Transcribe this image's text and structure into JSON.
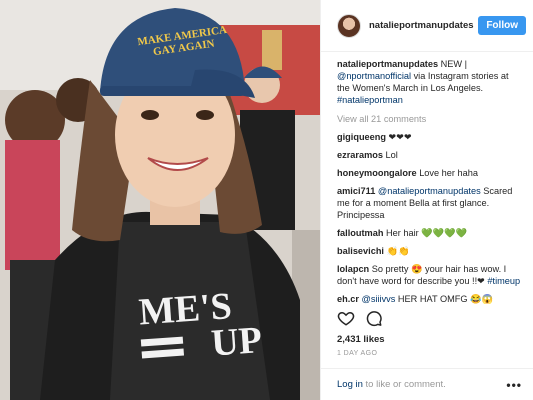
{
  "post": {
    "username": "natalieportmanupdates",
    "follow_label": "Follow",
    "caption_user": "natalieportmanupdates",
    "caption_text_1": " NEW | ",
    "caption_mention": "@nportmanofficial",
    "caption_text_2": " via Instagram stories at the Women's March in Los Angeles. ",
    "caption_hashtag": "#natalieportman",
    "view_all": "View all 21 comments",
    "likes": "2,431 likes",
    "date": "1 DAY AGO",
    "login_link": "Log in",
    "login_text": " to like or comment.",
    "more": "•••"
  },
  "photo": {
    "cap_text_1": "MAKE AMERICA",
    "cap_text_2": "GAY AGAIN",
    "shirt_text_1": "ME'S",
    "shirt_text_2": "UP",
    "cap_color": "#2f4f7a",
    "shirt_color": "#2b2b2b"
  },
  "comments": [
    {
      "user": "gigiqueeng",
      "parts": [
        {
          "t": " ❤❤❤"
        }
      ]
    },
    {
      "user": "ezraramos",
      "parts": [
        {
          "t": " Lol"
        }
      ]
    },
    {
      "user": "honeymoongalore",
      "parts": [
        {
          "t": " Love her haha"
        }
      ]
    },
    {
      "user": "amici711",
      "parts": [
        {
          "t": " "
        },
        {
          "t": "@natalieportmanupdates",
          "link": true
        },
        {
          "t": " Scared me for a moment Bella at first glance. Principessa"
        }
      ]
    },
    {
      "user": "falloutmah",
      "parts": [
        {
          "t": " Her hair 💚💚💚💚"
        }
      ]
    },
    {
      "user": "balisevichi",
      "parts": [
        {
          "t": " 👏👏"
        }
      ]
    },
    {
      "user": "lolapcn",
      "parts": [
        {
          "t": " So pretty 😍 your hair has wow. I don't have word for describe you !!❤ "
        },
        {
          "t": "#timeup",
          "link": true
        }
      ]
    },
    {
      "user": "eh.cr",
      "parts": [
        {
          "t": " "
        },
        {
          "t": "@siiivvs",
          "link": true
        },
        {
          "t": " HER HAT OMFG 😂😱"
        }
      ]
    }
  ]
}
